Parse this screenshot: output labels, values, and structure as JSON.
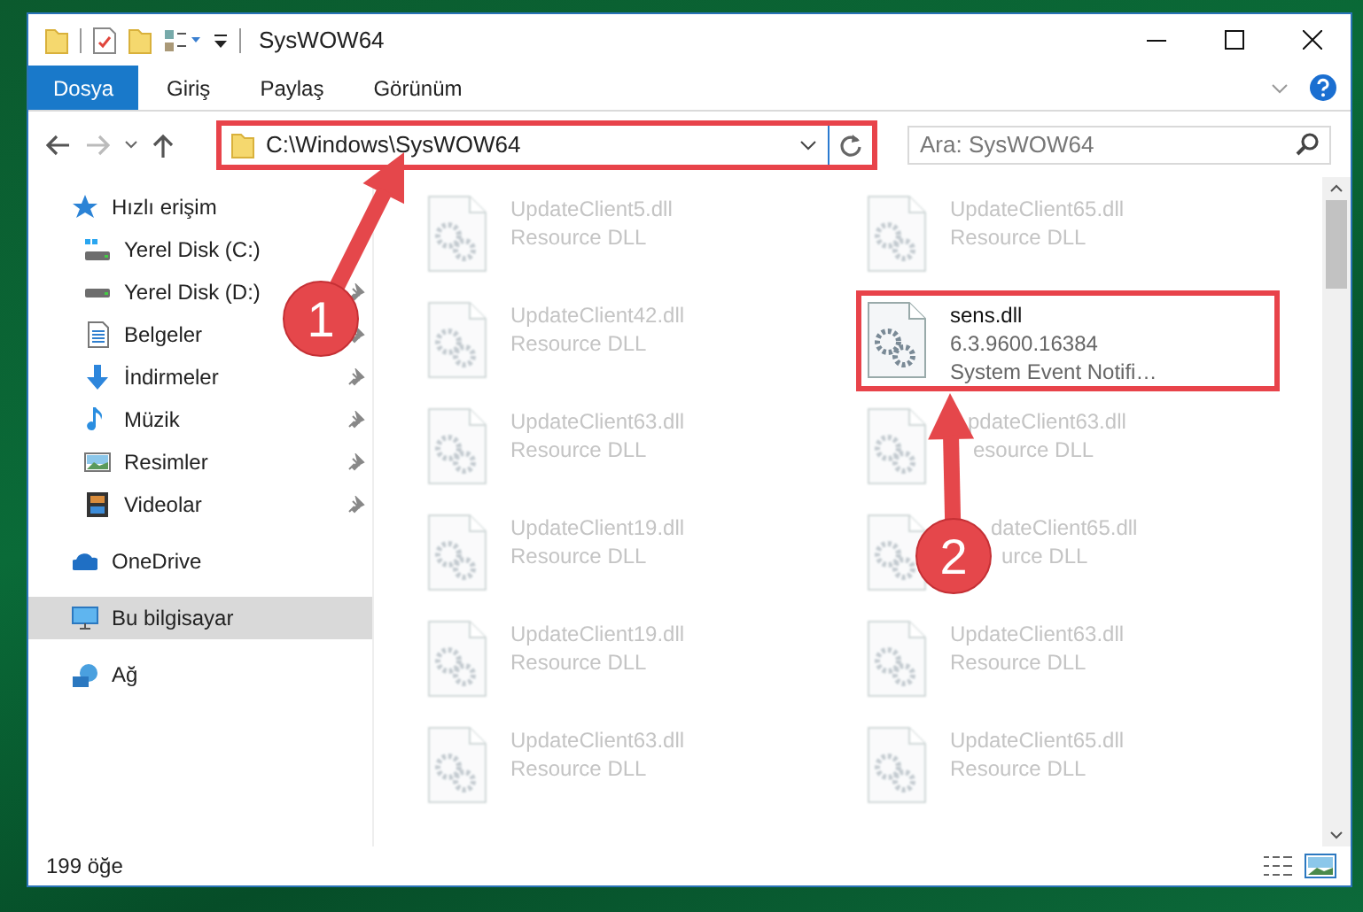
{
  "window": {
    "title": "SysWOW64"
  },
  "ribbon_tabs": [
    {
      "label": "Dosya",
      "selected": true
    },
    {
      "label": "Giriş",
      "selected": false
    },
    {
      "label": "Paylaş",
      "selected": false
    },
    {
      "label": "Görünüm",
      "selected": false
    }
  ],
  "address_bar": {
    "path": "C:\\Windows\\SysWOW64",
    "highlighted": true
  },
  "search": {
    "placeholder": "Ara: SysWOW64"
  },
  "sidebar": {
    "items": [
      {
        "label": "Hızlı erişim",
        "kind": "star",
        "selected": false,
        "children": [
          {
            "label": "Yerel Disk (C:)",
            "kind": "drive-c",
            "pinned": false
          },
          {
            "label": "Yerel Disk (D:)",
            "kind": "drive",
            "pinned": true
          },
          {
            "label": "Belgeler",
            "kind": "document",
            "pinned": true
          },
          {
            "label": "İndirmeler",
            "kind": "download",
            "pinned": true
          },
          {
            "label": "Müzik",
            "kind": "music",
            "pinned": true
          },
          {
            "label": "Resimler",
            "kind": "image",
            "pinned": true
          },
          {
            "label": "Videolar",
            "kind": "film",
            "pinned": true
          }
        ]
      },
      {
        "label": "OneDrive",
        "kind": "cloud",
        "selected": false
      },
      {
        "label": "Bu bilgisayar",
        "kind": "computer",
        "selected": true
      },
      {
        "label": "Ağ",
        "kind": "network",
        "selected": false
      }
    ]
  },
  "files": [
    {
      "name": "UpdateClient5.dll",
      "details": [
        "Resource DLL"
      ],
      "blurred": true,
      "highlighted": false
    },
    {
      "name": "UpdateClient65.dll",
      "details": [
        "Resource DLL"
      ],
      "blurred": true,
      "highlighted": false
    },
    {
      "name": "UpdateClient42.dll",
      "details": [
        "Resource DLL"
      ],
      "blurred": true,
      "highlighted": false
    },
    {
      "name": "sens.dll",
      "details": [
        "6.3.9600.16384",
        "System Event Notifi…"
      ],
      "blurred": false,
      "highlighted": true
    },
    {
      "name": "UpdateClient63.dll",
      "details": [
        "Resource DLL"
      ],
      "blurred": true,
      "highlighted": false
    },
    {
      "name": "pdateClient63.dll",
      "details": [
        "esource DLL"
      ],
      "blurred": true,
      "highlighted": false
    },
    {
      "name": "UpdateClient19.dll",
      "details": [
        "Resource DLL"
      ],
      "blurred": true,
      "highlighted": false
    },
    {
      "name": "dateClient65.dll",
      "details": [
        "urce DLL"
      ],
      "blurred": true,
      "highlighted": false
    },
    {
      "name": "UpdateClient19.dll",
      "details": [
        "Resource DLL"
      ],
      "blurred": true,
      "highlighted": false
    },
    {
      "name": "UpdateClient63.dll",
      "details": [
        "Resource DLL"
      ],
      "blurred": true,
      "highlighted": false
    },
    {
      "name": "UpdateClient63.dll",
      "details": [
        "Resource DLL"
      ],
      "blurred": true,
      "highlighted": false
    },
    {
      "name": "UpdateClient65.dll",
      "details": [
        "Resource DLL"
      ],
      "blurred": true,
      "highlighted": false
    }
  ],
  "status_bar": {
    "item_count": "199 öğe"
  },
  "annotations": [
    {
      "label": "1"
    },
    {
      "label": "2"
    }
  ]
}
